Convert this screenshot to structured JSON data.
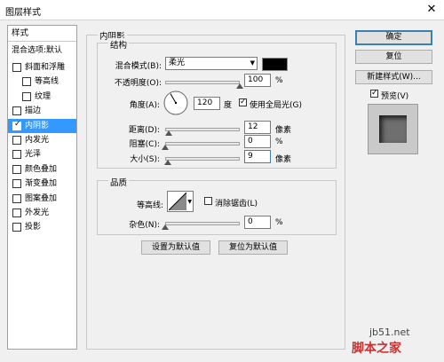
{
  "window": {
    "title": "图层样式",
    "close_glyph": "✕"
  },
  "left_panel": {
    "header": "样式",
    "blend_default": "混合选项:默认",
    "items": [
      {
        "label": "斜面和浮雕",
        "checked": false,
        "indent": false,
        "active": false
      },
      {
        "label": "等高线",
        "checked": false,
        "indent": true,
        "active": false
      },
      {
        "label": "纹理",
        "checked": false,
        "indent": true,
        "active": false
      },
      {
        "label": "描边",
        "checked": false,
        "indent": false,
        "active": false
      },
      {
        "label": "内阴影",
        "checked": true,
        "indent": false,
        "active": true
      },
      {
        "label": "内发光",
        "checked": false,
        "indent": false,
        "active": false
      },
      {
        "label": "光泽",
        "checked": false,
        "indent": false,
        "active": false
      },
      {
        "label": "颜色叠加",
        "checked": false,
        "indent": false,
        "active": false
      },
      {
        "label": "渐变叠加",
        "checked": false,
        "indent": false,
        "active": false
      },
      {
        "label": "图案叠加",
        "checked": false,
        "indent": false,
        "active": false
      },
      {
        "label": "外发光",
        "checked": false,
        "indent": false,
        "active": false
      },
      {
        "label": "投影",
        "checked": false,
        "indent": false,
        "active": false
      }
    ]
  },
  "inner_shadow": {
    "title": "内阴影",
    "structure": {
      "title": "结构",
      "blend_mode_label": "混合模式(B):",
      "blend_mode_value": "柔光",
      "blend_color": "#000000",
      "opacity_label": "不透明度(O):",
      "opacity_value": "100",
      "opacity_fraction": 1.0,
      "percent": "%",
      "angle_label": "角度(A):",
      "angle_value": "120",
      "angle_unit": "度",
      "global_light_label": "使用全局光(G)",
      "global_light_checked": true,
      "distance_label": "距离(D):",
      "distance_value": "12",
      "distance_fraction": 0.05,
      "choke_label": "阻塞(C):",
      "choke_value": "0",
      "choke_fraction": 0.0,
      "size_label": "大小(S):",
      "size_value": "9",
      "size_fraction": 0.036,
      "pixel_unit": "像素"
    },
    "quality": {
      "title": "品质",
      "contour_label": "等高线:",
      "antialias_label": "消除锯齿(L)",
      "antialias_checked": false,
      "noise_label": "杂色(N):",
      "noise_value": "0",
      "noise_fraction": 0.0
    },
    "set_default_button": "设置为默认值",
    "reset_default_button": "复位为默认值"
  },
  "right": {
    "ok_button": "确定",
    "reset_button": "复位",
    "new_style_button": "新建样式(W)...",
    "preview_label": "预览(V)",
    "preview_checked": true
  },
  "watermark": {
    "line1": "jb51.net",
    "line2": "脚本之家"
  }
}
